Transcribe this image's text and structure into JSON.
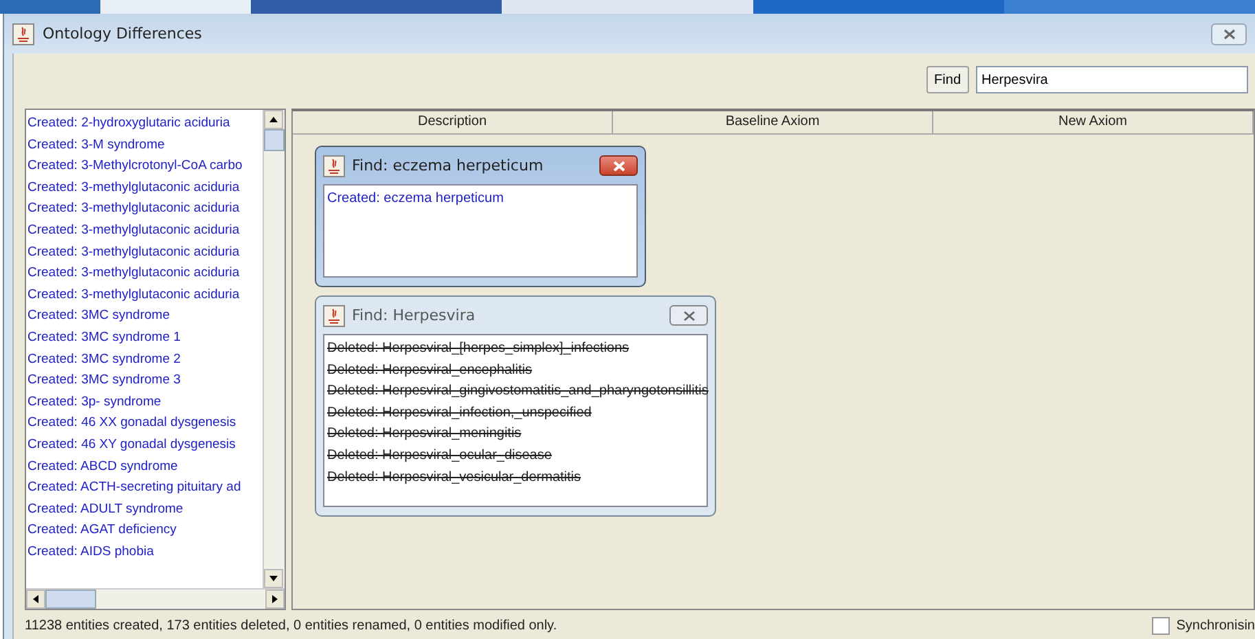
{
  "window": {
    "title": "Ontology Differences"
  },
  "toolbar": {
    "find_button": "Find",
    "search": {
      "value": "Herpesvira"
    }
  },
  "entity_list": {
    "items": [
      {
        "text": "Created: 2-hydroxyglutaric aciduria",
        "kind": "created"
      },
      {
        "text": "Created: 3-M syndrome",
        "kind": "created"
      },
      {
        "text": "Created: 3-Methylcrotonyl-CoA carbo",
        "kind": "created"
      },
      {
        "text": "Created: 3-methylglutaconic aciduria",
        "kind": "created"
      },
      {
        "text": "Created: 3-methylglutaconic aciduria",
        "kind": "created"
      },
      {
        "text": "Created: 3-methylglutaconic aciduria",
        "kind": "created"
      },
      {
        "text": "Created: 3-methylglutaconic aciduria",
        "kind": "created"
      },
      {
        "text": "Created: 3-methylglutaconic aciduria",
        "kind": "created"
      },
      {
        "text": "Created: 3-methylglutaconic aciduria",
        "kind": "created"
      },
      {
        "text": "Created: 3MC syndrome",
        "kind": "created"
      },
      {
        "text": "Created: 3MC syndrome 1",
        "kind": "created"
      },
      {
        "text": "Created: 3MC syndrome 2",
        "kind": "created"
      },
      {
        "text": "Created: 3MC syndrome 3",
        "kind": "created"
      },
      {
        "text": "Created: 3p- syndrome",
        "kind": "created"
      },
      {
        "text": "Created: 46 XX gonadal dysgenesis",
        "kind": "created"
      },
      {
        "text": "Created: 46 XY gonadal dysgenesis",
        "kind": "created"
      },
      {
        "text": "Created: ABCD syndrome",
        "kind": "created"
      },
      {
        "text": "Created: ACTH-secreting pituitary ad",
        "kind": "created"
      },
      {
        "text": "Created: ADULT syndrome",
        "kind": "created"
      },
      {
        "text": "Created: AGAT deficiency",
        "kind": "created"
      },
      {
        "text": "Created: AIDS phobia",
        "kind": "created"
      }
    ]
  },
  "table": {
    "columns": [
      "Description",
      "Baseline Axiom",
      "New Axiom"
    ]
  },
  "dialogs": [
    {
      "title": "Find: eczema herpeticum",
      "active": true,
      "items": [
        {
          "text": "Created: eczema herpeticum",
          "kind": "created"
        }
      ]
    },
    {
      "title": "Find: Herpesvira",
      "active": false,
      "items": [
        {
          "text": "Deleted: Herpesviral_[herpes_simplex]_infections",
          "kind": "deleted"
        },
        {
          "text": "Deleted: Herpesviral_encephalitis",
          "kind": "deleted"
        },
        {
          "text": "Deleted: Herpesviral_gingivostomatitis_and_pharyngotonsillitis",
          "kind": "deleted"
        },
        {
          "text": "Deleted: Herpesviral_infection,_unspecified",
          "kind": "deleted"
        },
        {
          "text": "Deleted: Herpesviral_meningitis",
          "kind": "deleted"
        },
        {
          "text": "Deleted: Herpesviral_ocular_disease",
          "kind": "deleted"
        },
        {
          "text": "Deleted: Herpesviral_vesicular_dermatitis",
          "kind": "deleted"
        }
      ]
    }
  ],
  "status_bar": {
    "text": "11238 entities created, 173 entities deleted, 0 entities renamed, 0 entities modified only.",
    "sync": {
      "label": "Synchronisin",
      "checked": false
    }
  }
}
